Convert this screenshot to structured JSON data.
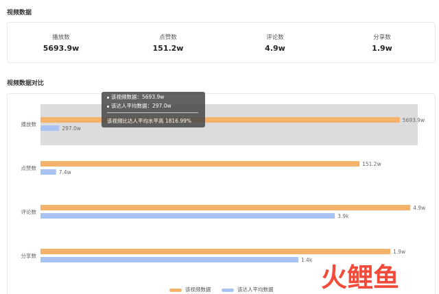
{
  "sections": {
    "video_data_title": "视频数据",
    "comparison_title": "视频数据对比"
  },
  "stats": [
    {
      "label": "播放数",
      "value": "5693.9w"
    },
    {
      "label": "点赞数",
      "value": "151.2w"
    },
    {
      "label": "评论数",
      "value": "4.9w"
    },
    {
      "label": "分享数",
      "value": "1.9w"
    }
  ],
  "tooltip": {
    "line1": "该视频数据：5693.9w",
    "line2": "该达人平均数据：297.0w",
    "summary": "该视频比达人平均水平高 1816.99%"
  },
  "colors": {
    "video": "#f5b26b",
    "average": "#a9c4f2",
    "highlight": "#dcdcdc"
  },
  "watermark": {
    "text": "火鲤鱼"
  },
  "chart_data": {
    "type": "bar",
    "orientation": "horizontal",
    "categories": [
      "播放数",
      "点赞数",
      "评论数",
      "分享数"
    ],
    "series": [
      {
        "name": "该视频数据",
        "values": [
          5693.9,
          151.2,
          4.9,
          1.9
        ],
        "labels": [
          "5693.9w",
          "151.2w",
          "4.9w",
          "1.9w"
        ]
      },
      {
        "name": "该达人平均数据",
        "values": [
          297.0,
          7.4,
          3.9,
          1.4
        ],
        "labels": [
          "297.0w",
          "7.4w",
          "3.9k",
          "1.4k"
        ]
      }
    ],
    "note": "each category scaled to its own maximum",
    "highlighted_category": "播放数",
    "legend": "bottom-center",
    "grid": false
  }
}
